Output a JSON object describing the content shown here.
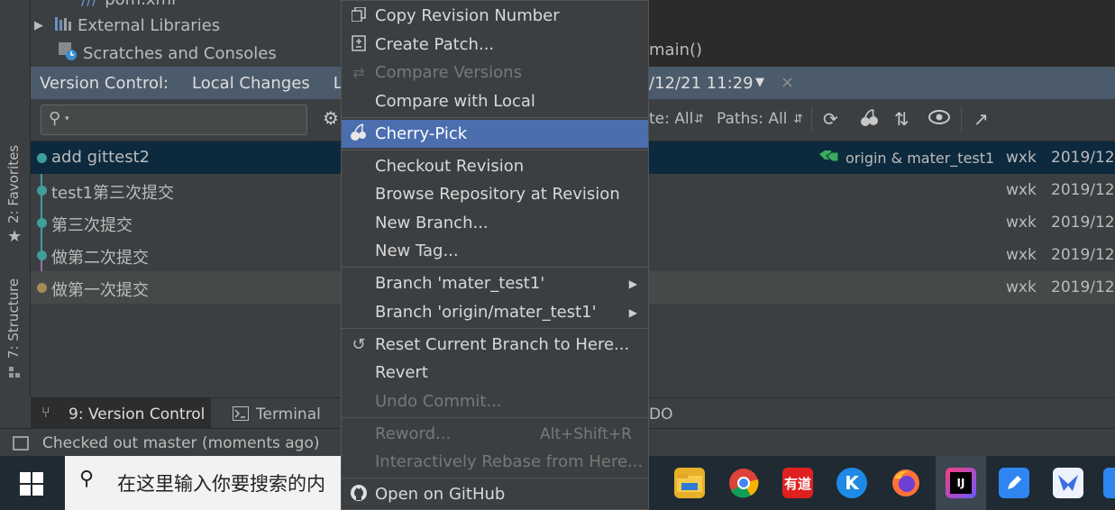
{
  "left_stripe": {
    "favorites_label": "2: Favorites",
    "structure_label": "7: Structure"
  },
  "project_tree": {
    "items": [
      {
        "label": "pom.xml"
      },
      {
        "label": "External Libraries"
      },
      {
        "label": "Scratches and Consoles"
      }
    ]
  },
  "editor": {
    "method_fragment": "main()"
  },
  "vc_header": {
    "title": "Version Control:",
    "tabs": [
      "Local Changes",
      "L"
    ],
    "filter_date": "/12/21 11:29"
  },
  "toolbar": {
    "search_placeholder": "",
    "date_filter": "te: All",
    "paths_filter": "Paths: All"
  },
  "log": {
    "commits": [
      {
        "subject": "add gittest2",
        "refs": "origin & mater_test1",
        "author": "wxk",
        "date": "2019/12"
      },
      {
        "subject": "test1第三次提交",
        "refs": "",
        "author": "wxk",
        "date": "2019/12"
      },
      {
        "subject": "第三次提交",
        "refs": "",
        "author": "wxk",
        "date": "2019/12"
      },
      {
        "subject": "做第二次提交",
        "refs": "",
        "author": "wxk",
        "date": "2019/12"
      },
      {
        "subject": "做第一次提交",
        "refs": "",
        "author": "wxk",
        "date": "2019/12"
      }
    ]
  },
  "tool_windows": {
    "version_control": "9: Version Control",
    "terminal": "Terminal",
    "todo_fragment": "DO"
  },
  "status_bar": {
    "message": "Checked out master (moments ago)"
  },
  "taskbar": {
    "search_placeholder": "在这里输入你要搜索的内",
    "youdao_label": "有道"
  },
  "context_menu": {
    "items": [
      {
        "label": "Copy Revision Number",
        "icon": "copy-icon",
        "enabled": true
      },
      {
        "label": "Create Patch...",
        "icon": "patch-icon",
        "enabled": true
      },
      {
        "label": "Compare Versions",
        "icon": "compare-icon",
        "enabled": false
      },
      {
        "label": "Compare with Local",
        "icon": "",
        "enabled": true
      },
      {
        "label": "Cherry-Pick",
        "icon": "cherry-icon",
        "enabled": true,
        "selected": true
      },
      {
        "label": "Checkout Revision",
        "icon": "",
        "enabled": true
      },
      {
        "label": "Browse Repository at Revision",
        "icon": "",
        "enabled": true
      },
      {
        "label": "New Branch...",
        "icon": "",
        "enabled": true
      },
      {
        "label": "New Tag...",
        "icon": "",
        "enabled": true
      },
      {
        "label": "Branch 'mater_test1'",
        "icon": "",
        "enabled": true,
        "submenu": true
      },
      {
        "label": "Branch 'origin/mater_test1'",
        "icon": "",
        "enabled": true,
        "submenu": true
      },
      {
        "label": "Reset Current Branch to Here...",
        "icon": "reset-icon",
        "enabled": true
      },
      {
        "label": "Revert",
        "icon": "",
        "enabled": true
      },
      {
        "label": "Undo Commit...",
        "icon": "",
        "enabled": false
      },
      {
        "label": "Reword...",
        "icon": "",
        "enabled": false,
        "shortcut": "Alt+Shift+R"
      },
      {
        "label": "Interactively Rebase from Here...",
        "icon": "",
        "enabled": false
      },
      {
        "label": "Open on GitHub",
        "icon": "github-icon",
        "enabled": true
      }
    ]
  },
  "colors": {
    "selection": "#4b6eaf",
    "row_selected": "#0d293e",
    "graph": "#3f9e9c",
    "ref_tag": "#3aaa5c"
  }
}
